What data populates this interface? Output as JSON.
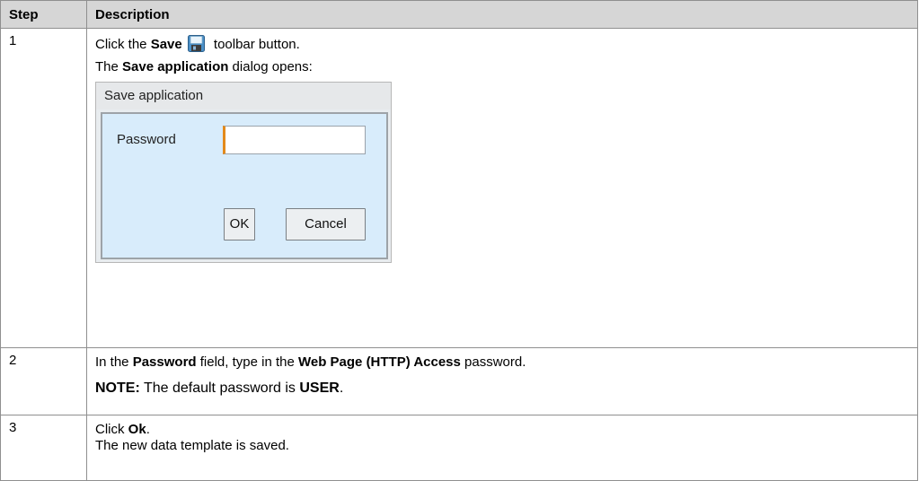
{
  "headers": {
    "step": "Step",
    "description": "Description"
  },
  "row1": {
    "step": "1",
    "line1_pre": "Click the ",
    "line1_bold": "Save",
    "line1_post": " toolbar button.",
    "line2_pre": "The ",
    "line2_bold": "Save application",
    "line2_post": " dialog opens:",
    "save_icon": "floppy-disk-icon",
    "dialog": {
      "title": "Save application",
      "password_label": "Password",
      "password_value": "",
      "ok_label": "OK",
      "cancel_label": "Cancel",
      "accent_color": "#e38a1b"
    }
  },
  "row2": {
    "step": "2",
    "pre": "In the ",
    "bold1": "Password",
    "mid": " field, type in the ",
    "bold2": "Web Page (HTTP) Access",
    "post": " password.",
    "note_label": "NOTE:",
    "note_pre": " The default password is ",
    "note_bold": "USER",
    "note_post": "."
  },
  "row3": {
    "step": "3",
    "line1_pre": "Click ",
    "line1_bold": "Ok",
    "line1_post": ".",
    "line2": "The new data template is saved."
  }
}
